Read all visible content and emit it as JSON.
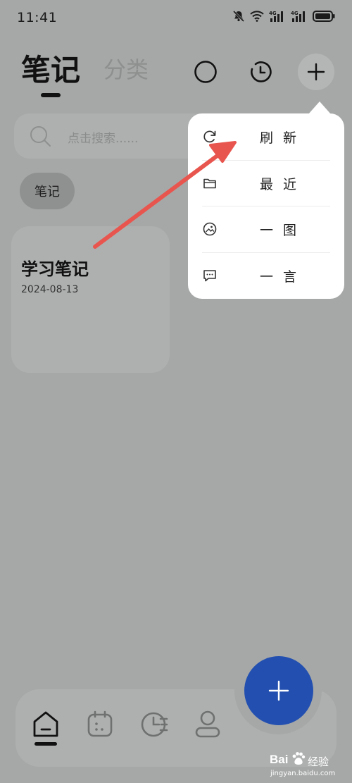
{
  "status_bar": {
    "time": "11:41"
  },
  "header": {
    "tab_active": "笔记",
    "tab_inactive": "分类"
  },
  "search": {
    "placeholder": "点击搜索......"
  },
  "filter_chip": {
    "label": "笔记"
  },
  "notes": [
    {
      "title": "学习笔记",
      "date": "2024-08-13"
    }
  ],
  "menu": {
    "items": [
      {
        "label": "刷新",
        "icon": "refresh-icon"
      },
      {
        "label": "最近",
        "icon": "folder-icon"
      },
      {
        "label": "一图",
        "icon": "image-icon"
      },
      {
        "label": "一言",
        "icon": "message-icon"
      }
    ]
  },
  "bottom_nav": {
    "items": [
      {
        "icon": "home-icon",
        "active": true
      },
      {
        "icon": "calendar-icon",
        "active": false
      },
      {
        "icon": "history-icon",
        "active": false
      },
      {
        "icon": "profile-icon",
        "active": false
      }
    ]
  },
  "watermark": {
    "brand": "Bai",
    "brand_suffix": "经验",
    "url": "jingyan.baidu.com"
  },
  "colors": {
    "background": "#a6a8a7",
    "fab": "#2350b0",
    "menu": "#ffffff",
    "annotation_arrow": "#e8554e"
  }
}
